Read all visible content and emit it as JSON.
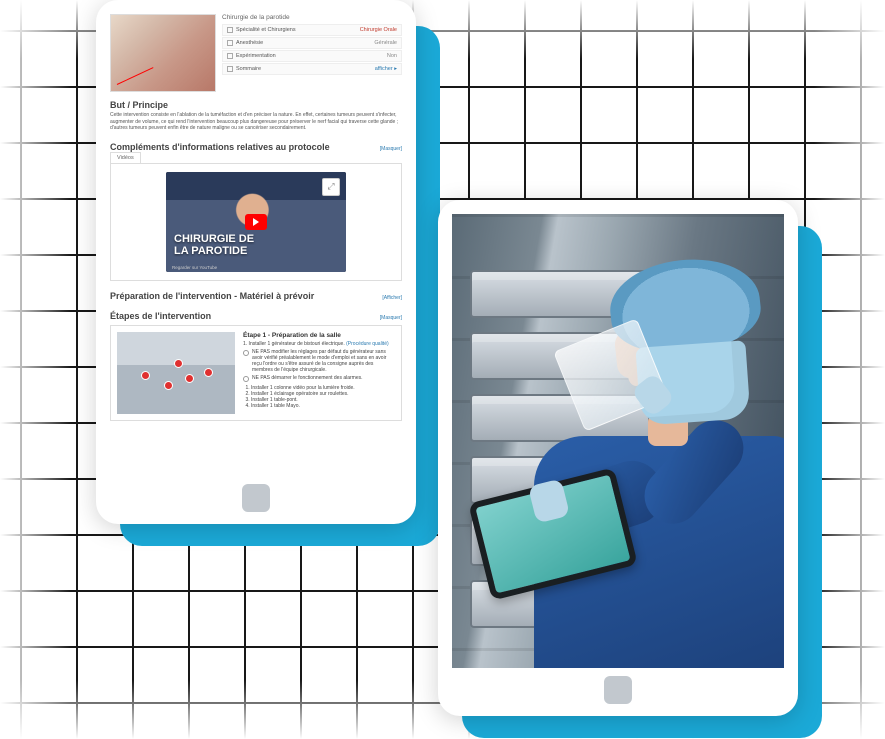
{
  "protocol": {
    "header_title": "Chirurgie de la parotide",
    "meta_rows": [
      {
        "icon": "team-icon",
        "label": "Spécialité et Chirurgiens",
        "value": "Chirurgie Orale",
        "value_style": "red"
      },
      {
        "icon": "anesthesia-icon",
        "label": "Anesthésie",
        "value": "Générale",
        "value_style": ""
      },
      {
        "icon": "hospital-icon",
        "label": "Expérimentation",
        "value": "Non",
        "value_style": ""
      },
      {
        "icon": "list-icon",
        "label": "Sommaire",
        "value": "afficher ▸",
        "value_style": "blue"
      }
    ],
    "section_but_title": "But / Principe",
    "section_but_text": "Cette intervention consiste en l'ablation de la tuméfaction et d'en préciser la nature. En effet, certaines tumeurs peuvent s'infecter, augmenter de volume, ce qui rend l'intervention beaucoup plus dangereuse pour préserver le nerf facial qui traverse cette glande ; d'autres tumeurs peuvent enfin être de nature maligne ou se cancériser secondairement.",
    "section_compl_title": "Compléments d'informations relatives au protocole",
    "link_hide": "[Masquer]",
    "link_show": "[Afficher]",
    "tab_videos": "Vidéos",
    "video_overlay_line1": "CHIRURGIE DE",
    "video_overlay_line2": "LA PAROTIDE",
    "video_watch_on": "Regarder sur YouTube",
    "section_prep_title": "Préparation de l'intervention - Matériel à prévoir",
    "section_steps_title": "Étapes de l'intervention",
    "step1": {
      "title": "Étape 1 - Préparation de la salle",
      "subtitle_prefix": "1. Installer 1 générateur de bistouri électrique.",
      "subtitle_link": "(Procédure qualité)",
      "checks": [
        "NE PAS modifier les réglages par défaut du générateur sans avoir vérifié préalablement le mode d'emploi et sans en avoir reçu l'ordre ou s'être assuré de la consigne auprès des membres de l'équipe chirurgicale.",
        "NE PAS démarrer le fonctionnement des alarmes."
      ],
      "list": [
        "Installer 1 colonne vidéo pour la lumière froide.",
        "Installer 1 éclairage opératoire sur roulettes.",
        "Installer 1 table-pont.",
        "Installer 1 table Mayo."
      ]
    }
  }
}
